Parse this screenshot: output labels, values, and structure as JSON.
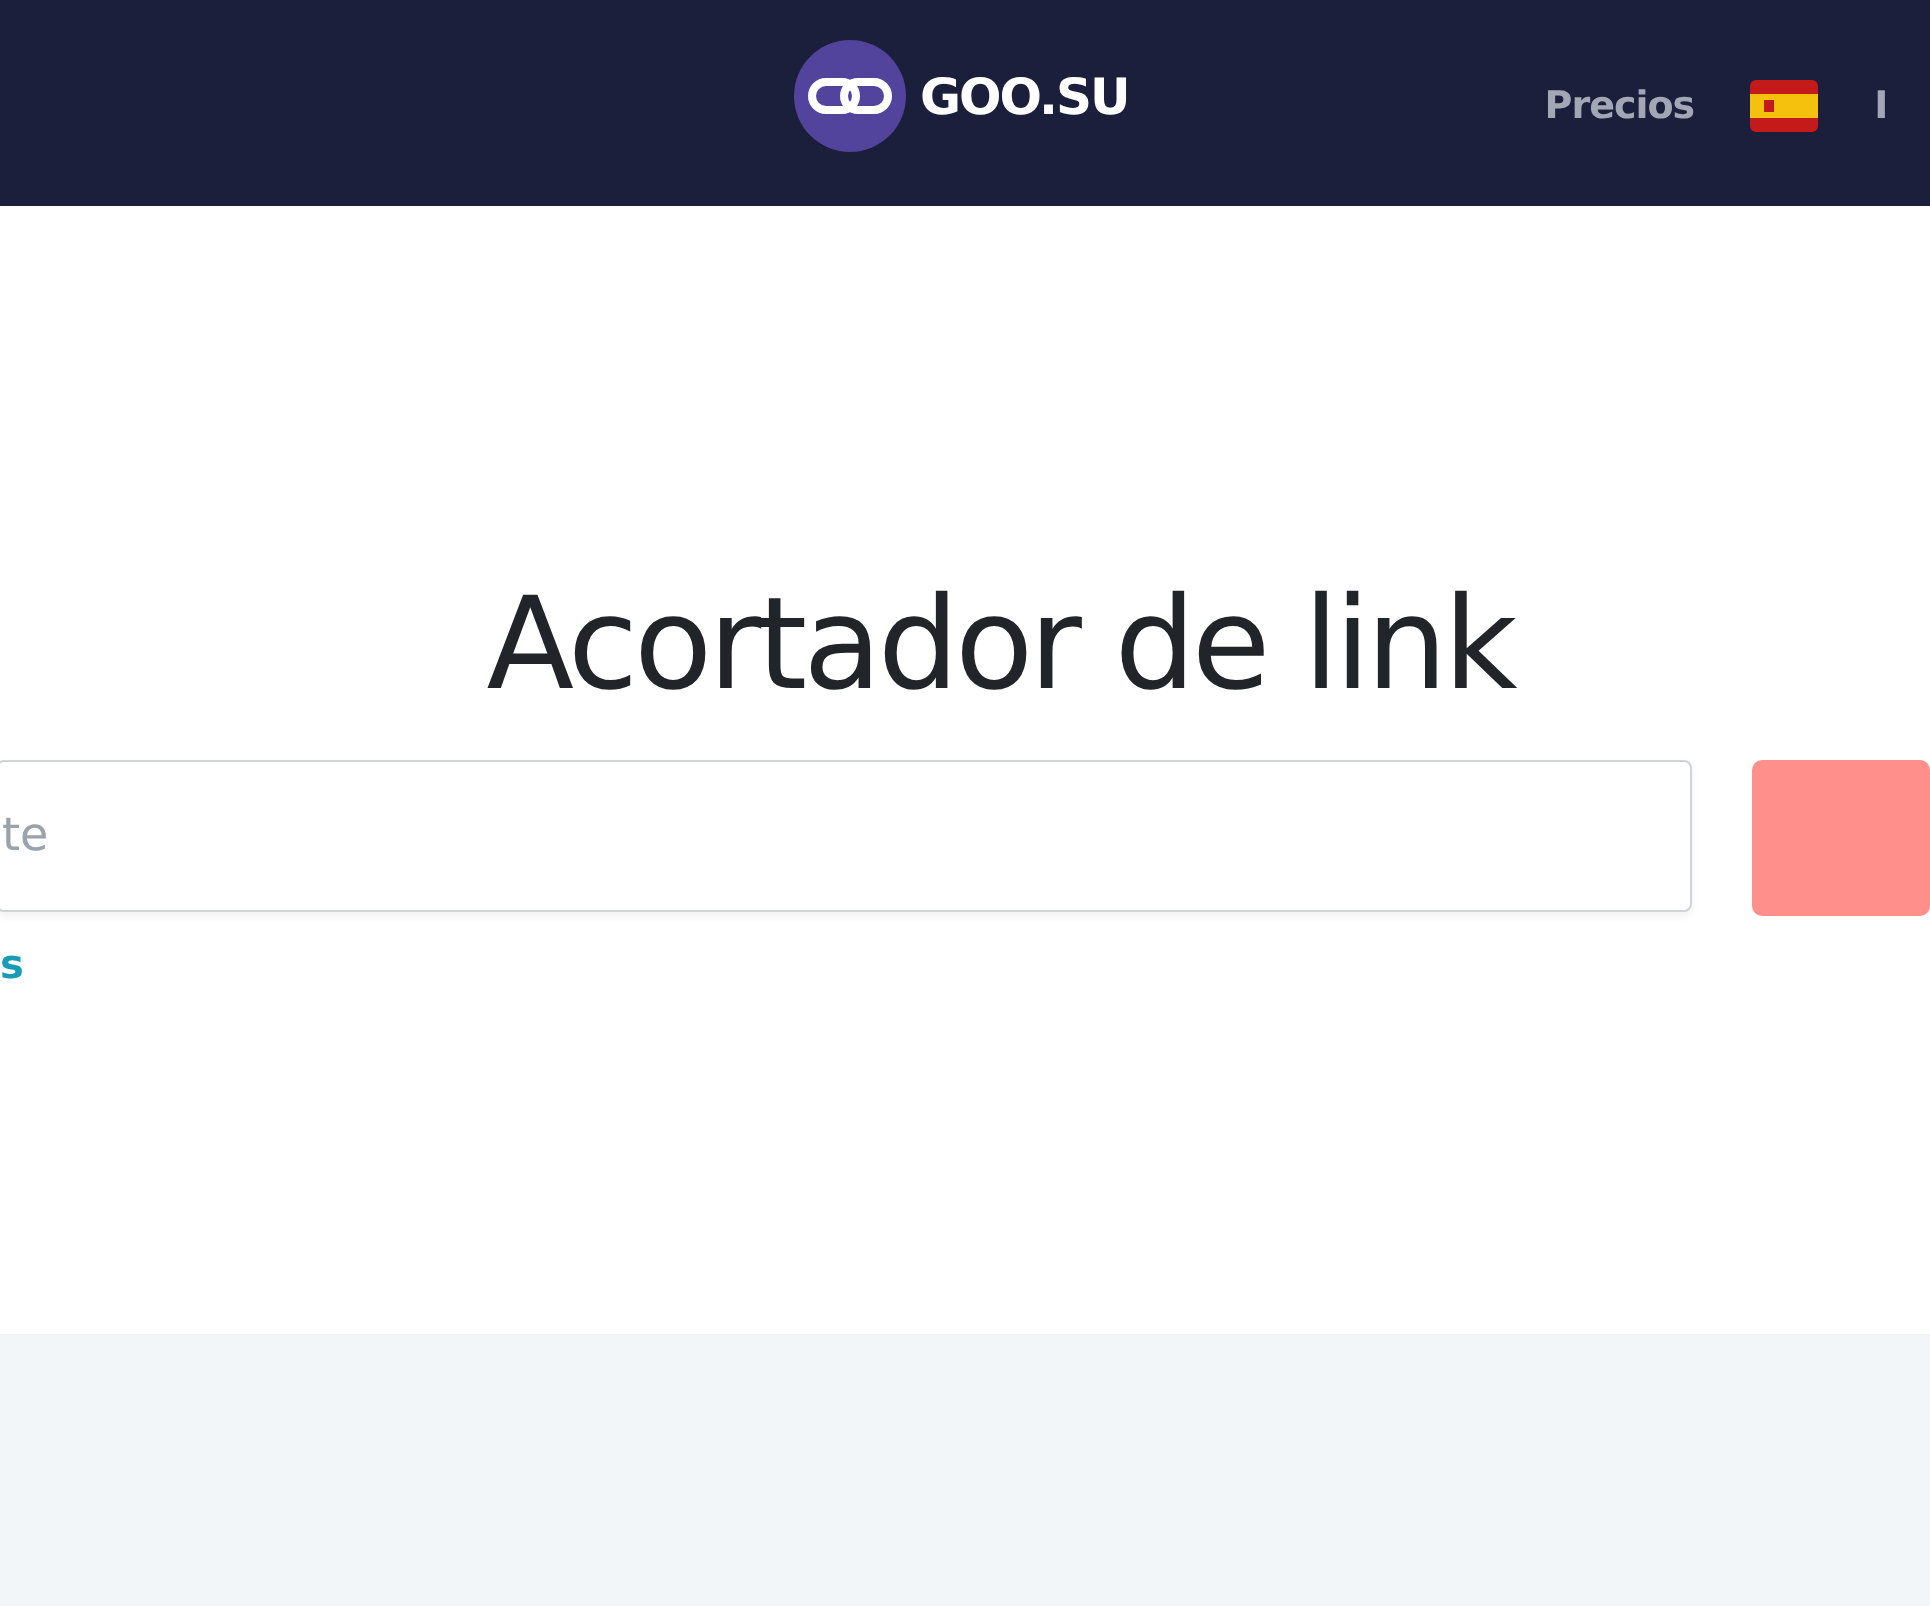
{
  "header": {
    "logo": "GOO.SU",
    "nav": [
      {
        "label": "Precios",
        "kind": "link"
      },
      {
        "kind": "flag"
      },
      {
        "label": "I",
        "kind": "link"
      }
    ]
  },
  "hero": {
    "title": "Acortador de link",
    "url_field": {
      "placeholder": "te"
    },
    "link": "s"
  }
}
